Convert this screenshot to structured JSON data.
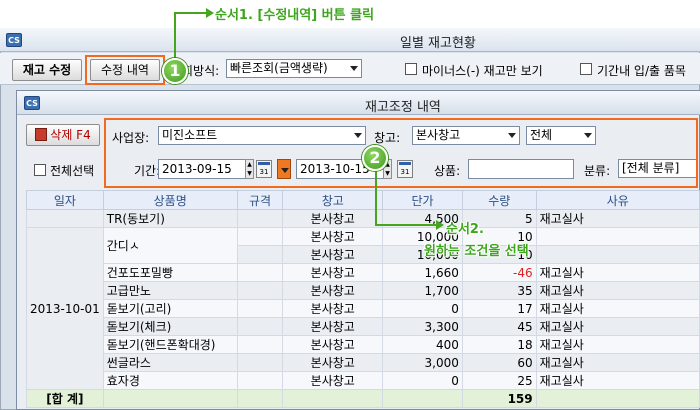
{
  "main_window": {
    "title": "일별 재고현황",
    "icon": "cs-app-icon",
    "inventory_button": "재고 수정",
    "edit_history_button": "수정 내역",
    "mode_label": "회방식:",
    "mode_value": "빠른조회(금액생략)",
    "minus_only_label": "마이너스(-) 재고만 보기",
    "period_label": "기간내 입/출 품목"
  },
  "dialog": {
    "title": "재고조정 내역",
    "delete_button": "삭제 F4",
    "company_label": "사업장:",
    "company_value": "미진소프트",
    "warehouse_label": "창고:",
    "warehouse_value": "본사창고",
    "all_value": "전체",
    "select_all_label": "전체선택",
    "period_label": "기간:",
    "date_from": "2013-09-15",
    "date_to": "2013-10-15",
    "product_label": "상품:",
    "product_value": "",
    "category_label": "분류:",
    "category_value": "[전체 분류]"
  },
  "grid": {
    "columns": [
      "일자",
      "상품명",
      "규격",
      "창고",
      "단가",
      "수량",
      "사유"
    ],
    "date_group": "2013-10-01",
    "rows": [
      {
        "name": "TR(동보기)",
        "spec": "",
        "warehouse": "본사창고",
        "price": "4,500",
        "qty": "5",
        "reason": "재고실사"
      },
      {
        "name": "간디ㅅ",
        "spec": "",
        "warehouse": "본사창고",
        "price": "10,000",
        "qty": "10",
        "reason": ""
      },
      {
        "name": "",
        "spec": "",
        "warehouse": "본사창고",
        "price": "10,000",
        "qty": "10",
        "reason": ""
      },
      {
        "name": "건포도포밀빵",
        "spec": "",
        "warehouse": "본사창고",
        "price": "1,660",
        "qty": "-46",
        "reason": "재고실사"
      },
      {
        "name": "고급만노",
        "spec": "",
        "warehouse": "본사창고",
        "price": "1,700",
        "qty": "35",
        "reason": "재고실사"
      },
      {
        "name": "돋보기(고리)",
        "spec": "",
        "warehouse": "본사창고",
        "price": "0",
        "qty": "17",
        "reason": "재고실사"
      },
      {
        "name": "돋보기(체크)",
        "spec": "",
        "warehouse": "본사창고",
        "price": "3,300",
        "qty": "45",
        "reason": "재고실사"
      },
      {
        "name": "돋보기(핸드폰확대경)",
        "spec": "",
        "warehouse": "본사창고",
        "price": "400",
        "qty": "18",
        "reason": "재고실사"
      },
      {
        "name": "썬글라스",
        "spec": "",
        "warehouse": "본사창고",
        "price": "3,000",
        "qty": "60",
        "reason": "재고실사"
      },
      {
        "name": "효자경",
        "spec": "",
        "warehouse": "본사창고",
        "price": "0",
        "qty": "25",
        "reason": "재고실사"
      }
    ],
    "total_label": "[합 계]",
    "total_qty": "159"
  },
  "annotations": {
    "step1_number": "1",
    "step1_text": "순서1. [수정내역] 버튼 클릭",
    "step2_number": "2",
    "step2_line1": "순서2.",
    "step2_line2": "원하는 조건을 선택"
  },
  "colors": {
    "highlight": "#f06a20",
    "annotation_green": "#46a51f",
    "negative": "#e02020",
    "total_row": "#e2f1d8"
  }
}
